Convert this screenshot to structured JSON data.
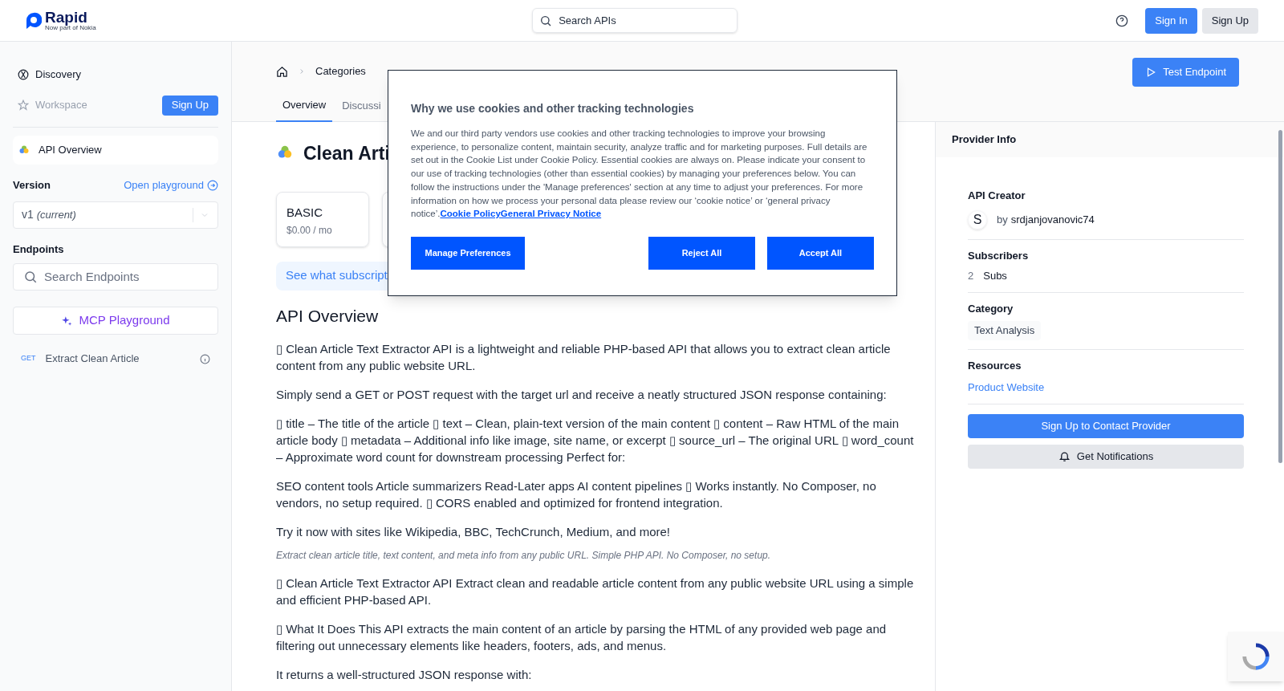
{
  "header": {
    "logo": {
      "name": "Rapid",
      "tagline": "Now part of Nokia"
    },
    "search": {
      "placeholder": "Search APIs"
    },
    "buttons": [
      {
        "label": "Sign In",
        "kind": "primary"
      },
      {
        "label": "Sign Up",
        "kind": "secondary"
      }
    ]
  },
  "sidebar": {
    "nav": [
      {
        "label": "Discovery",
        "disabled": false
      },
      {
        "label": "Workspace",
        "disabled": true
      }
    ],
    "signup": "Sign Up",
    "api_overview": "API Overview",
    "version": {
      "label": "Version",
      "link": "Open playground",
      "value": "v1",
      "note": "(current)"
    },
    "endpoints": {
      "label": "Endpoints",
      "search_placeholder": "Search Endpoints",
      "mcp": "MCP Playground",
      "items": [
        {
          "method": "GET",
          "name": "Extract Clean Article"
        }
      ]
    }
  },
  "breadcrumb": [
    "Categories"
  ],
  "test_button": "Test Endpoint",
  "tabs": [
    {
      "label": "Overview",
      "selected": true
    },
    {
      "label": "Discussi",
      "selected": false
    }
  ],
  "title": "Clean Arti",
  "plans": [
    {
      "name": "BASIC",
      "price": "$0.00 / mo"
    }
  ],
  "banner": "See what subscript",
  "overview": {
    "heading": "API Overview",
    "paragraphs": [
      {
        "kind": "body",
        "text": "▯ Clean Article Text Extractor API is a lightweight and reliable PHP-based API that allows you to extract clean article content from any public website URL."
      },
      {
        "kind": "body",
        "text": "Simply send a GET or POST request with the target url and receive a neatly structured JSON response containing:"
      },
      {
        "kind": "body",
        "text": "▯ title – The title of the article ▯ text – Clean, plain-text version of the main content ▯ content – Raw HTML of the main article body ▯ metadata – Additional info like image, site name, or excerpt ▯ source_url – The original URL ▯ word_count – Approximate word count for downstream processing Perfect for:"
      },
      {
        "kind": "body",
        "text": "SEO content tools Article summarizers Read-Later apps AI content pipelines ▯ Works instantly. No Composer, no vendors, no setup required. ▯ CORS enabled and optimized for frontend integration."
      },
      {
        "kind": "body",
        "text": "Try it now with sites like Wikipedia, BBC, TechCrunch, Medium, and more!"
      },
      {
        "kind": "caption",
        "text": "Extract clean article title, text content, and meta info from any public URL. Simple PHP API. No Composer, no setup."
      },
      {
        "kind": "body",
        "text": "▯ Clean Article Text Extractor API Extract clean and readable article content from any public website URL using a simple and efficient PHP-based API."
      },
      {
        "kind": "body",
        "text": "▯ What It Does This API extracts the main content of an article by parsing the HTML of any provided web page and filtering out unnecessary elements like headers, footers, ads, and menus."
      },
      {
        "kind": "body",
        "text": "It returns a well-structured JSON response with:"
      }
    ]
  },
  "provider": {
    "title": "Provider Info",
    "creator_label": "API Creator",
    "avatar": "S",
    "by": "by",
    "creator": "srdjanjovanovic74",
    "subscribers_label": "Subscribers",
    "subscribers_count": "2",
    "subscribers_unit": "Subs",
    "category_label": "Category",
    "category": "Text Analysis",
    "resources_label": "Resources",
    "resource_link": "Product Website",
    "contact": "Sign Up to Contact Provider",
    "notify": "Get Notifications"
  },
  "cookie_dialog": {
    "title": "Why we use cookies and other tracking technologies",
    "body": "We and our third party vendors use cookies and other tracking technologies to improve your browsing experience, to personalize content, maintain security, analyze traffic and for marketing purposes. Full details are set out in the Cookie List under Cookie Policy. Essential cookies are always on. Please indicate your consent to our use of tracking technologies (other than essential cookies) by managing your preferences below. You can follow the instructions under the 'Manage preferences' section at any time to adjust your preferences. For more information on how we process your personal data please review our ‘cookie notice’ or ‘general privacy notice’.",
    "link": "Cookie PolicyGeneral Privacy Notice",
    "buttons": [
      "Manage Preferences",
      "Reject All",
      "Accept All"
    ]
  }
}
